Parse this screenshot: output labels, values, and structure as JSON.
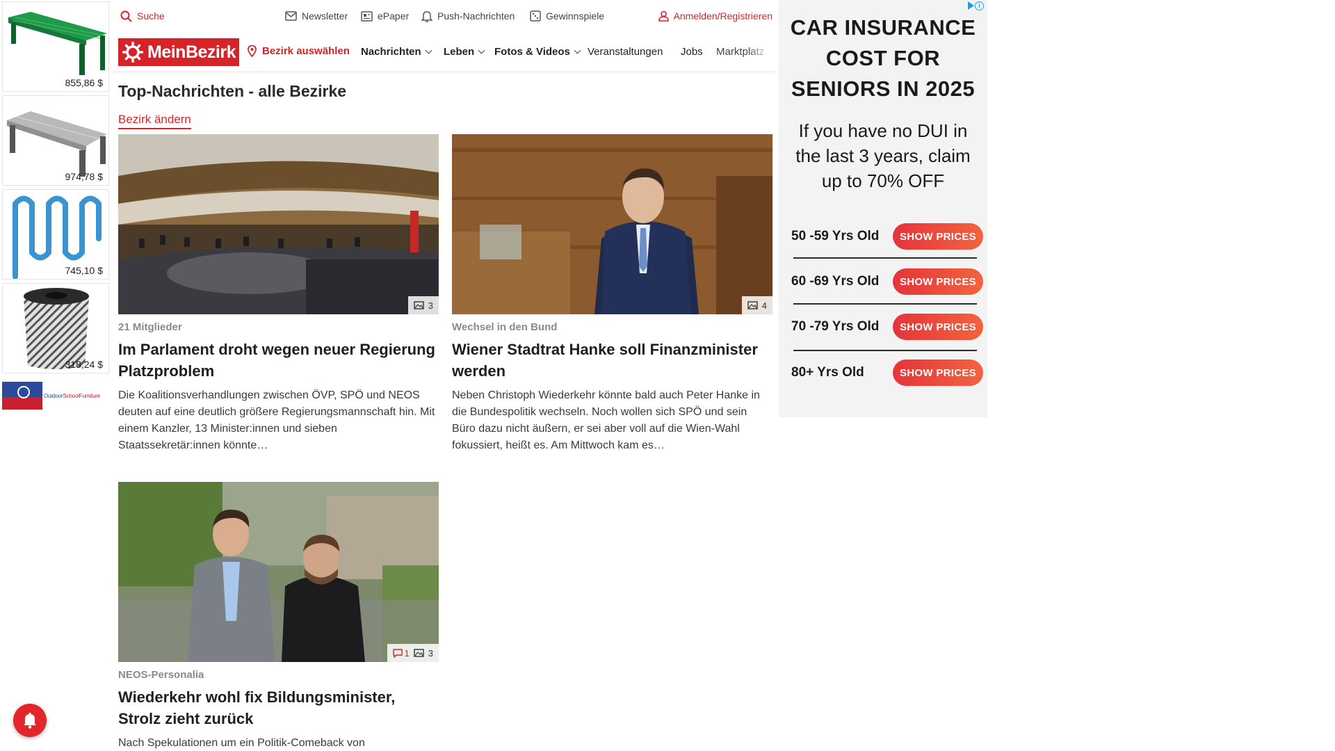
{
  "left_ad": {
    "products": [
      {
        "price": "855,86 $",
        "icon": "green-bench"
      },
      {
        "price": "974,78 $",
        "icon": "metal-bench"
      },
      {
        "price": "745,10 $",
        "icon": "bike-rack"
      },
      {
        "price": "318,24 $",
        "icon": "trash-can"
      }
    ],
    "brand_part1": "Outdoor",
    "brand_part2": "SchoolFurniture"
  },
  "header": {
    "search_label": "Suche",
    "newsletter_label": "Newsletter",
    "epaper_label": "ePaper",
    "push_label": "Push-Nachrichten",
    "games_label": "Gewinnspiele",
    "login_label": "Anmelden/Registrieren"
  },
  "nav": {
    "logo_text": "MeinBezirk",
    "district_label": "Bezirk auswählen",
    "items": [
      {
        "label": "Nachrichten"
      },
      {
        "label": "Leben"
      },
      {
        "label": "Fotos & Videos"
      },
      {
        "label": "Veranstaltungen"
      },
      {
        "label": "Jobs"
      },
      {
        "label": "Marktplatz"
      }
    ]
  },
  "page": {
    "title": "Top-Nachrichten - alle Bezirke",
    "change_district_label": "Bezirk ändern"
  },
  "articles": [
    {
      "kicker": "21 Mitglieder",
      "headline": "Im Parlament droht wegen neuer Regierung Platzproblem",
      "teaser": "Die Koalitionsverhandlungen zwischen ÖVP, SPÖ und NEOS deuten auf eine deutlich größere Regierungsmannschaft hin. Mit einem Kanzler, 13 Minister:innen und sieben Staatssekretär:innen könnte…",
      "photo_count": "3",
      "comment_count": ""
    },
    {
      "kicker": "Wechsel in den Bund",
      "headline": "Wiener Stadtrat Hanke soll Finanzminister werden",
      "teaser": "Neben Christoph Wiederkehr könnte bald auch Peter Hanke in die Bundespolitik wechseln. Noch wollen sich SPÖ und sein Büro dazu nicht äußern, er sei aber voll auf die Wien-Wahl fokussiert, heißt es. Am Mittwoch kam es…",
      "photo_count": "4",
      "comment_count": ""
    },
    {
      "kicker": "NEOS-Personalia",
      "headline": "Wiederkehr wohl fix Bildungsminister, Strolz zieht zurück",
      "teaser": "Nach Spekulationen um ein Politik-Comeback von",
      "photo_count": "3",
      "comment_count": "1"
    }
  ],
  "right_ad": {
    "title_line1": "CAR INSURANCE",
    "title_line2": "COST FOR",
    "title_line3": "SENIORS IN 2025",
    "subtitle": "If you have no DUI in the last 3 years, claim up to 70% OFF",
    "rows": [
      {
        "age": "50 -59 Yrs Old",
        "button": "SHOW PRICES"
      },
      {
        "age": "60 -69 Yrs Old",
        "button": "SHOW PRICES"
      },
      {
        "age": "70 -79 Yrs Old",
        "button": "SHOW PRICES"
      },
      {
        "age": "80+ Yrs Old",
        "button": "SHOW PRICES"
      }
    ]
  },
  "colors": {
    "brand_red": "#d6232a",
    "ad_background": "#f3f3f3",
    "ad_button": "#e5343c"
  }
}
